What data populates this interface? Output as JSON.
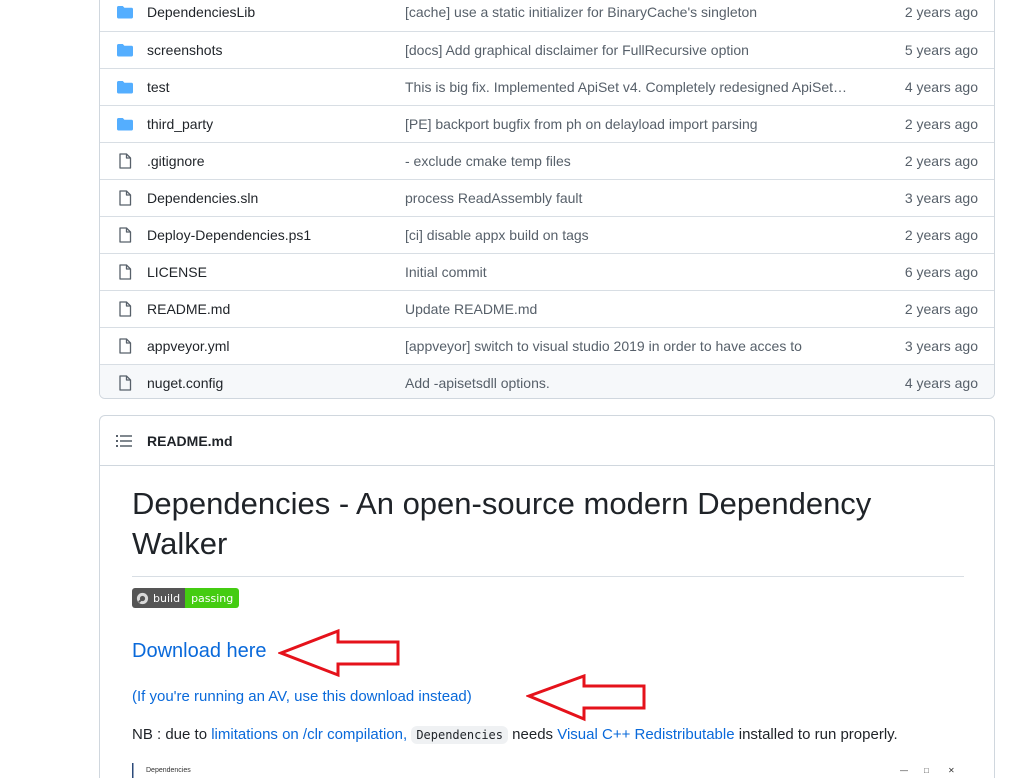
{
  "files": [
    {
      "type": "dir",
      "name": "DependenciesLib",
      "message": "[cache] use a static initializer for BinaryCache's singleton",
      "age": "2 years ago"
    },
    {
      "type": "dir",
      "name": "screenshots",
      "message": "[docs] Add graphical disclaimer for FullRecursive option",
      "age": "5 years ago"
    },
    {
      "type": "dir",
      "name": "test",
      "message": "This is big fix. Implemented ApiSet v4. Completely redesigned ApiSet …",
      "age": "4 years ago"
    },
    {
      "type": "dir",
      "name": "third_party",
      "message": "[PE] backport bugfix from ph on delayload import parsing",
      "age": "2 years ago"
    },
    {
      "type": "file",
      "name": ".gitignore",
      "message": "- exclude cmake temp files",
      "age": "2 years ago"
    },
    {
      "type": "file",
      "name": "Dependencies.sln",
      "message": "process ReadAssembly fault",
      "age": "3 years ago"
    },
    {
      "type": "file",
      "name": "Deploy-Dependencies.ps1",
      "message": "[ci] disable appx build on tags",
      "age": "2 years ago"
    },
    {
      "type": "file",
      "name": "LICENSE",
      "message": "Initial commit",
      "age": "6 years ago"
    },
    {
      "type": "file",
      "name": "README.md",
      "message": "Update README.md",
      "age": "2 years ago"
    },
    {
      "type": "file",
      "name": "appveyor.yml",
      "message": "[appveyor] switch to visual studio 2019 in order to have acces to",
      "age": "3 years ago"
    },
    {
      "type": "file",
      "name": "nuget.config",
      "message": "Add -apisetsdll options.",
      "age": "4 years ago"
    }
  ],
  "readme": {
    "header_title": "README.md",
    "h1": "Dependencies - An open-source modern Dependency Walker",
    "badge": {
      "left": "build",
      "right": "passing"
    },
    "download_link": "Download here",
    "av_link": "(If you're running an AV, use this download instead)",
    "nb": {
      "prefix": "NB : due to ",
      "link1": "limitations on /clr compilation,",
      "code": "Dependencies",
      "middle": " needs ",
      "link2": "Visual C++ Redistributable",
      "suffix": " installed to run properly."
    },
    "screenshot_title": "Dependencies",
    "screenshot_controls": [
      "—",
      "□",
      "✕"
    ]
  },
  "colors": {
    "folder": "#54aeff",
    "link": "#0969da",
    "annotation_arrow": "#e5121b",
    "badge_pass": "#44cc11"
  }
}
